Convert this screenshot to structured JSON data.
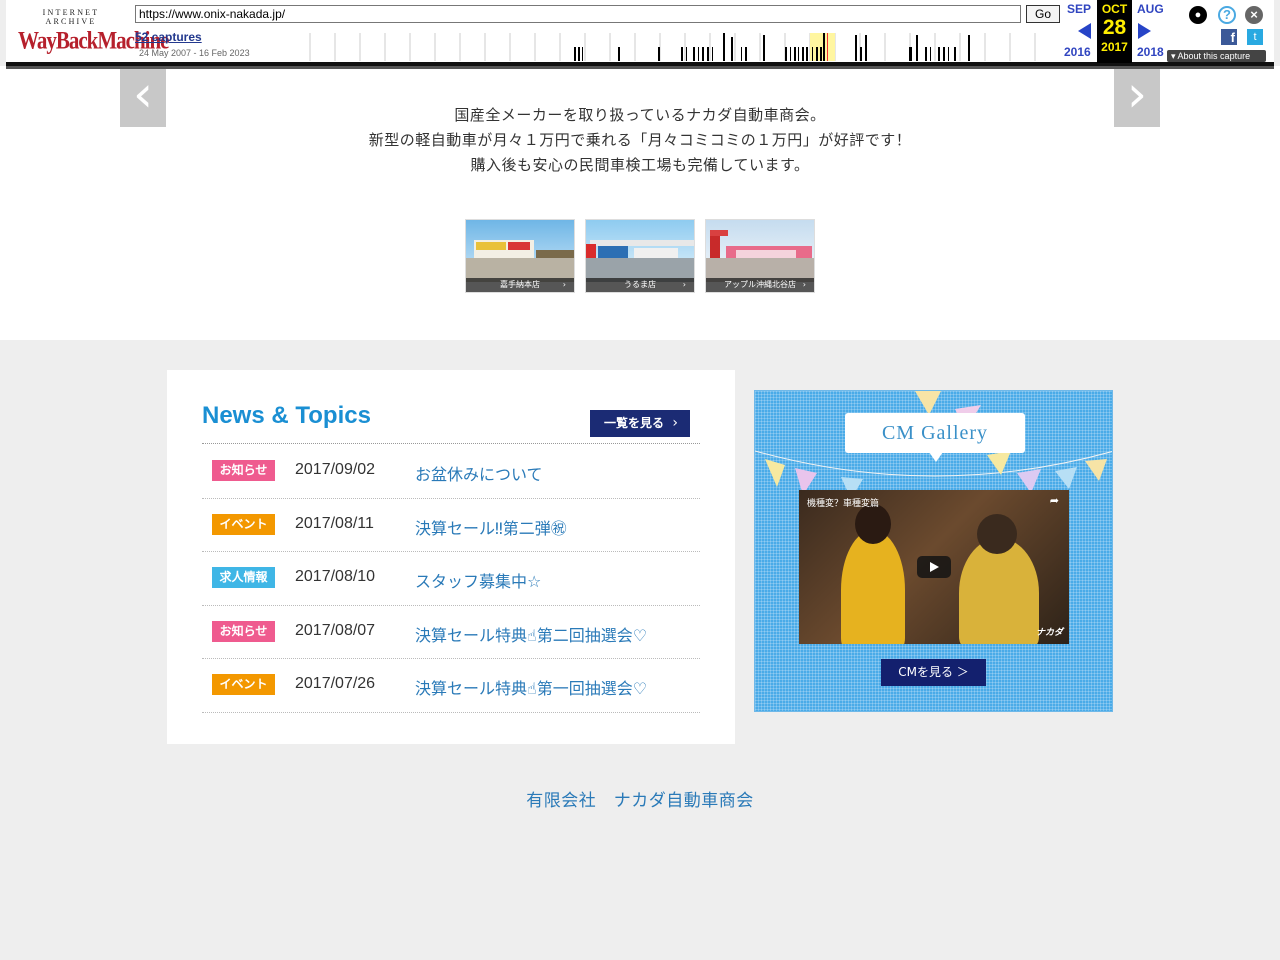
{
  "wayback": {
    "logo_top": "INTERNET ARCHIVE",
    "logo_main": "WayBackMachine",
    "url": "https://www.onix-nakada.jp/",
    "go_label": "Go",
    "captures": "52 captures",
    "date_range": "24 May 2007 - 16 Feb 2023",
    "prev_month": "SEP",
    "cur_month": "OCT",
    "next_month": "AUG",
    "cur_day": "28",
    "prev_year": "2016",
    "cur_year": "2017",
    "next_year": "2018",
    "about": "About this capture",
    "icons": [
      "user-icon",
      "help-icon",
      "close-icon",
      "facebook-icon",
      "twitter-icon"
    ]
  },
  "hero": {
    "prev_arrow": "‹",
    "next_arrow": "›",
    "intro_lines": [
      "国産全メーカーを取り扱っているナカダ自動車商会。",
      "新型の軽自動車が月々１万円で乗れる「月々コミコミの１万円」が好評です！",
      "購入後も安心の民間車検工場も完備しています。"
    ],
    "shops": [
      {
        "label": "嘉手納本店",
        "sky": "#7cc0ea",
        "accent": "#e43b3b"
      },
      {
        "label": "うるま店",
        "sky": "#9fd1f2",
        "accent": "#d92c2c"
      },
      {
        "label": "アップル沖縄北谷店",
        "sky": "#c9dff0",
        "accent": "#e9506a"
      }
    ]
  },
  "news": {
    "title": "News & Topics",
    "all_label": "一覧を見る",
    "items": [
      {
        "category": "お知らせ",
        "color": "#ef5b8f",
        "date": "2017/09/02",
        "title": "お盆休みについて"
      },
      {
        "category": "イベント",
        "color": "#f39800",
        "date": "2017/08/11",
        "title": "決算セール‼第二弾㊗"
      },
      {
        "category": "求人情報",
        "color": "#3fb6e6",
        "date": "2017/08/10",
        "title": "スタッフ募集中☆"
      },
      {
        "category": "お知らせ",
        "color": "#ef5b8f",
        "date": "2017/08/07",
        "title": "決算セール特典☝第二回抽選会♡"
      },
      {
        "category": "イベント",
        "color": "#f39800",
        "date": "2017/07/26",
        "title": "決算セール特典☝第一回抽選会♡"
      }
    ]
  },
  "cm": {
    "title": "CM Gallery",
    "video_title": "機種変？車種変篇",
    "video_logo": "ナカダ",
    "button_label": "CMを見る ＞"
  },
  "footer": {
    "company": "有限会社　ナカダ自動車商会"
  }
}
